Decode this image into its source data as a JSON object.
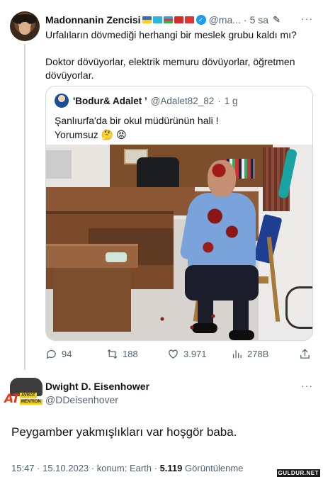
{
  "tweet": {
    "author_name": "Madonnanin Zencisi",
    "author_flags": [
      "flag-ua",
      "flag-kz",
      "flag-az",
      "flag-kg",
      "flag-tr"
    ],
    "handle": "@ma...",
    "separator": "·",
    "time": "5 sa",
    "more": "···",
    "text_line1": "Urfalıların dövmediği herhangi bir meslek grubu kaldı mı?",
    "text_line2": "Doktor dövüyorlar, elektrik memuru dövüyorlar, öğretmen dövüyorlar.",
    "quote": {
      "author_name": "'Bodur& Adalet ’",
      "handle": "@Adalet82_82",
      "separator": "·",
      "time": "1 g",
      "text_line1": "Şanlıurfa'da bir okul müdürünün hali !",
      "text_line2": "Yorumsuz 🤔 😡"
    },
    "actions": {
      "replies": "94",
      "retweets": "188",
      "likes": "3.971",
      "views": "278B"
    }
  },
  "reply": {
    "avatar_text_big": "AT",
    "avatar_text_small1": "AVRAT",
    "avatar_text_small2": "MENTION",
    "author_name": "Dwight D. Eisenhower",
    "handle": "@DDeisenhover",
    "more": "···",
    "text": "Peygamber yakmışlıkları var hoşgör baba.",
    "time": "15:47 · 15.10.2023 · konum: Earth · ",
    "views_count": "5.119",
    "views_label": " Görüntülenme"
  },
  "watermark": "GULDUR.NET",
  "colors": {
    "text": "#0f1419",
    "secondary": "#536471",
    "border": "#cfd9de",
    "verified": "#1d9bf0"
  }
}
